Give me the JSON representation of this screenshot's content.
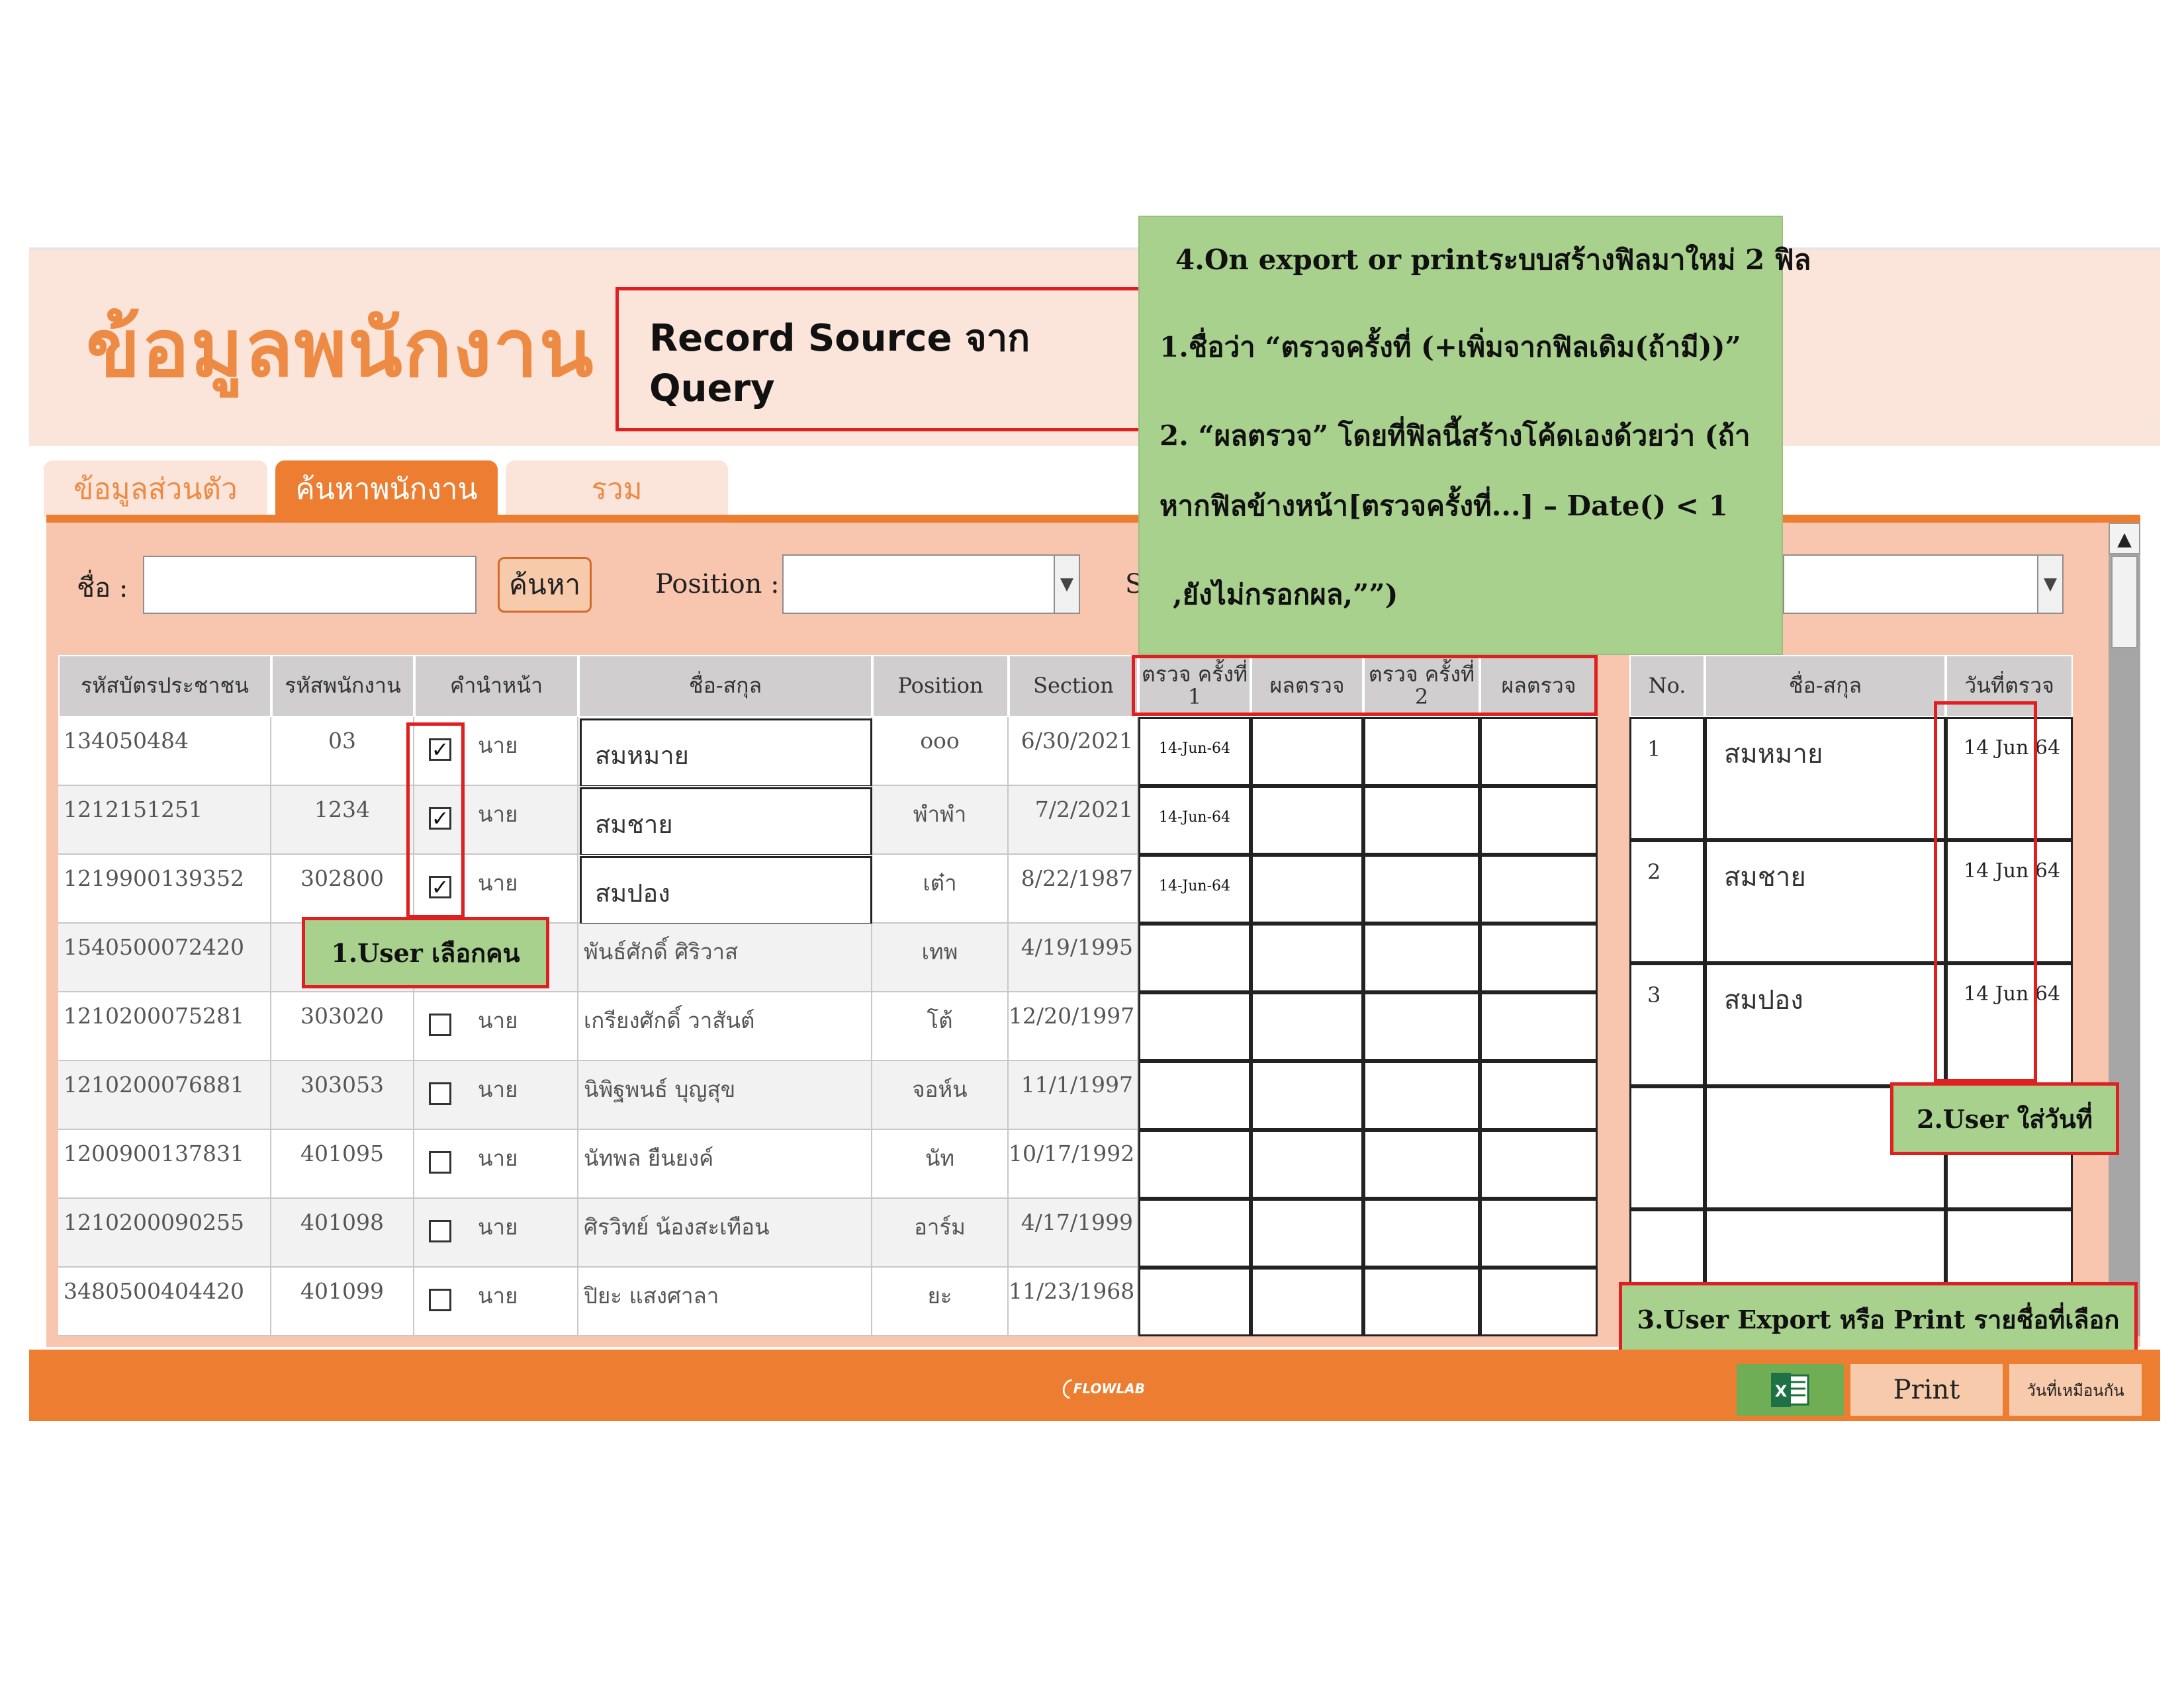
{
  "header": {
    "title": "ข้อมูลพนักงาน",
    "record_source": "Record Source จาก Query"
  },
  "tabs": [
    "ข้อมูลส่วนตัว",
    "ค้นหาพนักงาน",
    "รวม"
  ],
  "search": {
    "name_label": "ชื่อ :",
    "search_button": "ค้นหา",
    "position_label": "Position :",
    "section_label_partial": "S",
    "combo_arrow": "▼"
  },
  "grid": {
    "headers": [
      "รหัสบัตรประชาชน",
      "รหัสพนักงาน",
      "คำนำหน้า",
      "ชื่อ-สกุล",
      "Position",
      "Section"
    ],
    "check_headers": [
      "ตรวจ ครั้งที่ 1",
      "ผลตรวจ",
      "ตรวจ ครั้งที่ 2",
      "ผลตรวจ"
    ],
    "rows": [
      {
        "id_card": "134050484",
        "emp_no": "03",
        "prefix": "นาย",
        "name": "สมหมาย",
        "position": "ooo",
        "section": "6/30/2021",
        "checked": true,
        "check1": "14-Jun-64"
      },
      {
        "id_card": "1212151251",
        "emp_no": "1234",
        "prefix": "นาย",
        "name": "สมชาย",
        "position": "พำพำ",
        "section": "7/2/2021",
        "checked": true,
        "check1": "14-Jun-64"
      },
      {
        "id_card": "1219900139352",
        "emp_no": "302800",
        "prefix": "นาย",
        "name": "สมปอง",
        "position": "เต๋า",
        "section": "8/22/1987",
        "checked": true,
        "check1": "14-Jun-64"
      },
      {
        "id_card": "1540500072420",
        "emp_no": "",
        "prefix": "",
        "name": "พันธ์ศักดิ์ ศิริวาส",
        "position": "เทพ",
        "section": "4/19/1995",
        "checked": false,
        "check1": ""
      },
      {
        "id_card": "1210200075281",
        "emp_no": "303020",
        "prefix": "นาย",
        "name": "เกรียงศักดิ์ วาสันต์",
        "position": "โต้",
        "section": "12/20/1997",
        "checked": false,
        "check1": ""
      },
      {
        "id_card": "1210200076881",
        "emp_no": "303053",
        "prefix": "นาย",
        "name": "นิพิฐพนธ์ บุญสุข",
        "position": "จอห์น",
        "section": "11/1/1997",
        "checked": false,
        "check1": ""
      },
      {
        "id_card": "1200900137831",
        "emp_no": "401095",
        "prefix": "นาย",
        "name": "นัทพล ยืนยงค์",
        "position": "นัท",
        "section": "10/17/1992",
        "checked": false,
        "check1": ""
      },
      {
        "id_card": "1210200090255",
        "emp_no": "401098",
        "prefix": "นาย",
        "name": "ศิรวิทย์ น้องสะเทือน",
        "position": "อาร์ม",
        "section": "4/17/1999",
        "checked": false,
        "check1": ""
      },
      {
        "id_card": "3480500404420",
        "emp_no": "401099",
        "prefix": "นาย",
        "name": "ปิยะ แสงศาลา",
        "position": "ยะ",
        "section": "11/23/1968",
        "checked": false,
        "check1": ""
      }
    ]
  },
  "selected": {
    "headers": [
      "No.",
      "ชื่อ-สกุล",
      "วันที่ตรวจ"
    ],
    "rows": [
      {
        "no": "1",
        "name": "สมหมาย",
        "date": "14 Jun 64"
      },
      {
        "no": "2",
        "name": "สมชาย",
        "date": "14 Jun 64"
      },
      {
        "no": "3",
        "name": "สมปอง",
        "date": "14 Jun 64"
      }
    ]
  },
  "annotations": {
    "a1": "1.User เลือกคน",
    "a2": "2.User ใส่วันที่",
    "a3": "3.User Export หรือ Print รายชื่อที่เลือก",
    "note_lines": [
      "4.On export or printระบบสร้างฟิลมาใหม่ 2 ฟิล",
      "1.ชื่อว่า “ตรวจครั้งที่ (+เพิ่มจากฟิลเดิม(ถ้ามี))”",
      "2. “ผลตรวจ” โดยที่ฟิลนี้สร้างโค้ดเองด้วยว่า (ถ้า",
      "หากฟิลข้างหน้า[ตรวจครั้งที่...] – Date() < 1",
      ",ยังไม่กรอกผล,””)"
    ]
  },
  "footer": {
    "logo_text": "FLOWLAB",
    "print_button": "Print",
    "same_date_button": "วันที่เหมือนกัน"
  },
  "colors": {
    "accent": "#ed7d31",
    "title": "#ed8b45",
    "panel": "#f8c6ae",
    "header_bg": "#fbe4d9",
    "note_green": "#a9d18e",
    "highlight_red": "#e02020"
  }
}
